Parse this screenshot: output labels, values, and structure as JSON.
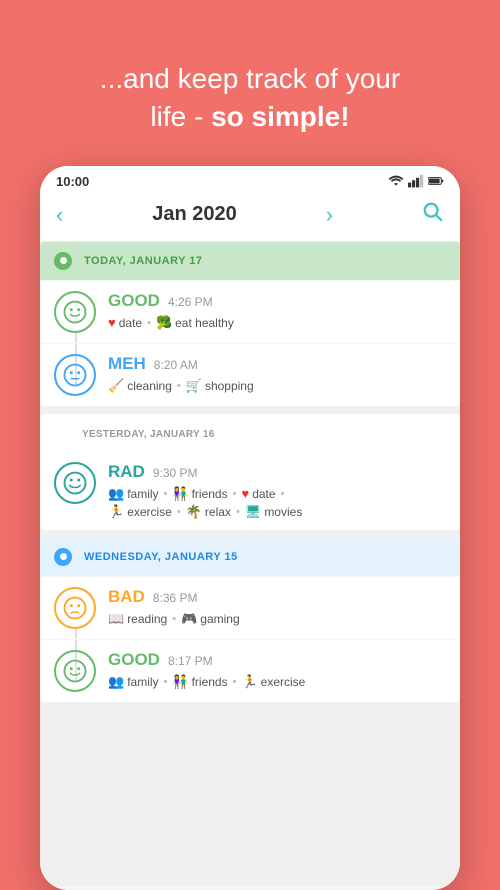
{
  "header": {
    "line1": "...and keep track of your",
    "line2": "life - ",
    "line2_bold": "so simple!"
  },
  "status_bar": {
    "time": "10:00"
  },
  "nav": {
    "prev_arrow": "‹",
    "next_arrow": "›",
    "month_year": "Jan 2020"
  },
  "days": [
    {
      "id": "today",
      "type": "today",
      "label": "TODAY, JANUARY 17",
      "entries": [
        {
          "mood": "GOOD",
          "mood_class": "good",
          "time": "4:26 PM",
          "tags": [
            {
              "icon": "♥",
              "label": "date"
            },
            {
              "icon": "🥦",
              "label": "eat healthy"
            }
          ]
        },
        {
          "mood": "MEH",
          "mood_class": "meh",
          "time": "8:20 AM",
          "tags": [
            {
              "icon": "🧹",
              "label": "cleaning"
            },
            {
              "icon": "🛒",
              "label": "shopping"
            }
          ]
        }
      ]
    },
    {
      "id": "yesterday",
      "type": "yesterday",
      "label": "YESTERDAY, JANUARY 16",
      "entries": [
        {
          "mood": "RAD",
          "mood_class": "rad",
          "time": "9:30 PM",
          "tags": [
            {
              "icon": "👥",
              "label": "family"
            },
            {
              "icon": "👫",
              "label": "friends"
            },
            {
              "icon": "♥",
              "label": "date"
            },
            {
              "icon": "🏃",
              "label": "exercise"
            },
            {
              "icon": "🌴",
              "label": "relax"
            },
            {
              "icon": "🖥",
              "label": "movies"
            }
          ]
        }
      ]
    },
    {
      "id": "wednesday",
      "type": "wednesday",
      "label": "WEDNESDAY, JANUARY 15",
      "entries": [
        {
          "mood": "BAD",
          "mood_class": "bad",
          "time": "8:36 PM",
          "tags": [
            {
              "icon": "📖",
              "label": "reading"
            },
            {
              "icon": "🎮",
              "label": "gaming"
            }
          ]
        },
        {
          "mood": "GOOD",
          "mood_class": "good",
          "time": "8:17 PM",
          "tags": [
            {
              "icon": "👥",
              "label": "family"
            },
            {
              "icon": "👫",
              "label": "friends"
            },
            {
              "icon": "🏃",
              "label": "exercise"
            }
          ]
        }
      ]
    }
  ]
}
